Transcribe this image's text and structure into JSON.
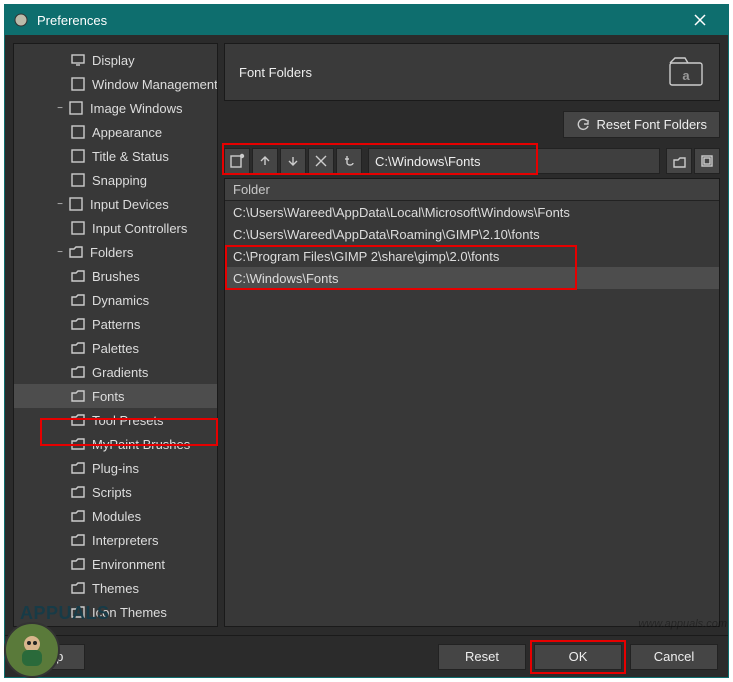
{
  "window": {
    "title": "Preferences"
  },
  "tree": {
    "items": [
      {
        "label": "Display",
        "depth": 3,
        "icon": "display-icon"
      },
      {
        "label": "Window Management",
        "depth": 3,
        "icon": "window-icon"
      },
      {
        "label": "Image Windows",
        "depth": 2,
        "icon": "image-icon",
        "expander": "−"
      },
      {
        "label": "Appearance",
        "depth": 3,
        "icon": "appearance-icon"
      },
      {
        "label": "Title & Status",
        "depth": 3,
        "icon": "title-icon"
      },
      {
        "label": "Snapping",
        "depth": 3,
        "icon": "snap-icon"
      },
      {
        "label": "Input Devices",
        "depth": 2,
        "icon": "input-icon",
        "expander": "−"
      },
      {
        "label": "Input Controllers",
        "depth": 3,
        "icon": "controller-icon"
      },
      {
        "label": "Folders",
        "depth": 2,
        "icon": "folder-icon",
        "expander": "−"
      },
      {
        "label": "Brushes",
        "depth": 3,
        "icon": "folder-icon"
      },
      {
        "label": "Dynamics",
        "depth": 3,
        "icon": "folder-icon"
      },
      {
        "label": "Patterns",
        "depth": 3,
        "icon": "folder-icon"
      },
      {
        "label": "Palettes",
        "depth": 3,
        "icon": "folder-icon"
      },
      {
        "label": "Gradients",
        "depth": 3,
        "icon": "folder-icon"
      },
      {
        "label": "Fonts",
        "depth": 3,
        "icon": "folder-icon",
        "selected": true
      },
      {
        "label": "Tool Presets",
        "depth": 3,
        "icon": "folder-icon"
      },
      {
        "label": "MyPaint Brushes",
        "depth": 3,
        "icon": "folder-icon"
      },
      {
        "label": "Plug-ins",
        "depth": 3,
        "icon": "folder-icon"
      },
      {
        "label": "Scripts",
        "depth": 3,
        "icon": "folder-icon"
      },
      {
        "label": "Modules",
        "depth": 3,
        "icon": "folder-icon"
      },
      {
        "label": "Interpreters",
        "depth": 3,
        "icon": "folder-icon"
      },
      {
        "label": "Environment",
        "depth": 3,
        "icon": "folder-icon"
      },
      {
        "label": "Themes",
        "depth": 3,
        "icon": "folder-icon"
      },
      {
        "label": "Icon Themes",
        "depth": 3,
        "icon": "folder-icon"
      }
    ]
  },
  "content": {
    "header_title": "Font Folders",
    "reset_button": "Reset Font Folders",
    "path_value": "C:\\Windows\\Fonts",
    "table_header": "Folder",
    "rows": [
      "C:\\Users\\Wareed\\AppData\\Local\\Microsoft\\Windows\\Fonts",
      "C:\\Users\\Wareed\\AppData\\Roaming\\GIMP\\2.10\\fonts",
      "C:\\Program Files\\GIMP 2\\share\\gimp\\2.0\\fonts",
      "C:\\Windows\\Fonts"
    ],
    "selected_row_index": 3
  },
  "footer": {
    "help": "Help",
    "reset": "Reset",
    "ok": "OK",
    "cancel": "Cancel"
  },
  "overlay": {
    "app_label": "APPUALS",
    "watermark": "www.appuals.com"
  }
}
